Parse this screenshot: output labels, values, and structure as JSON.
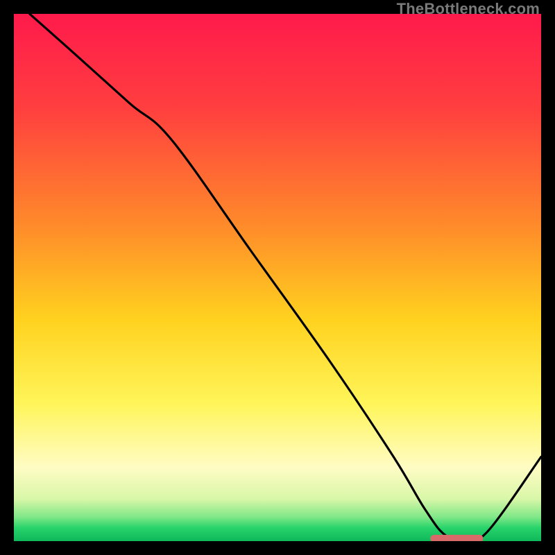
{
  "watermark": "TheBottleneck.com",
  "chart_data": {
    "type": "line",
    "title": "",
    "xlabel": "",
    "ylabel": "",
    "xlim": [
      0,
      100
    ],
    "ylim": [
      0,
      100
    ],
    "grid": false,
    "legend": false,
    "gradient_stops": [
      {
        "offset": 0.0,
        "color": "#ff1a4b"
      },
      {
        "offset": 0.18,
        "color": "#ff3f3f"
      },
      {
        "offset": 0.4,
        "color": "#ff8a2a"
      },
      {
        "offset": 0.58,
        "color": "#ffd21f"
      },
      {
        "offset": 0.74,
        "color": "#fff55a"
      },
      {
        "offset": 0.86,
        "color": "#fffcc4"
      },
      {
        "offset": 0.92,
        "color": "#d8f7a8"
      },
      {
        "offset": 0.955,
        "color": "#7ee787"
      },
      {
        "offset": 0.975,
        "color": "#27d36a"
      },
      {
        "offset": 1.0,
        "color": "#0fb85a"
      }
    ],
    "series": [
      {
        "name": "bottleneck-curve",
        "color": "#000000",
        "x": [
          3,
          12,
          22,
          30,
          45,
          60,
          72,
          78,
          82,
          86,
          90,
          100
        ],
        "y": [
          100,
          92,
          83,
          76,
          55,
          34,
          16,
          6,
          1,
          0.5,
          2,
          16
        ]
      }
    ],
    "marker": {
      "name": "optimal-range",
      "color": "#d86a6a",
      "x_start": 79,
      "x_end": 89,
      "y": 0.5,
      "thickness_pct": 1.4
    }
  }
}
